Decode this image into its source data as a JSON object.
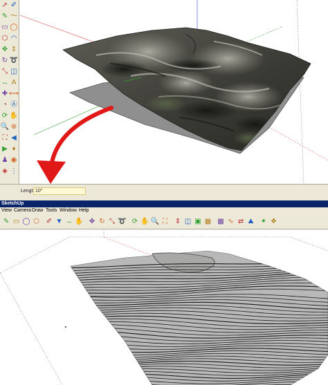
{
  "top": {
    "status_bar": {
      "length_label": "Length",
      "length_value": "10\""
    },
    "left_toolbar_icons": [
      "select-arrow-icon",
      "eraser-icon",
      "pencil-line-icon",
      "freehand-icon",
      "rectangle-icon",
      "circle-icon",
      "polygon-icon",
      "arc-icon",
      "move-icon",
      "push-pull-icon",
      "rotate-icon",
      "follow-me-icon",
      "scale-icon",
      "offset-icon",
      "tape-measure-icon",
      "text-icon",
      "axes-icon",
      "dimension-icon",
      "protractor-icon",
      "3d-text-icon",
      "orbit-icon",
      "pan-icon",
      "zoom-icon",
      "zoom-window-icon",
      "zoom-extents-icon",
      "previous-view-icon",
      "next-view-icon",
      "position-camera-icon",
      "walk-icon",
      "look-around-icon",
      "section-plane-icon",
      "footprints-icon"
    ],
    "terrain_colors": {
      "rock_dark": "#3d3d38",
      "rock_mid": "#6e6e66",
      "rock_light": "#9a9a90",
      "moss": "#5e6a4a",
      "plane": "#8f8f8f"
    },
    "arrow_color": "#e01818"
  },
  "bottom": {
    "window_title": "SketchUp",
    "menu": {
      "view": "View",
      "camera": "Camera",
      "draw": "Draw",
      "tools": "Tools",
      "window": "Window",
      "help": "Help"
    },
    "toolbar_icons": [
      "pencil-line-icon",
      "rectangle-icon",
      "circle-icon",
      "polygon-icon",
      "eraser-icon",
      "paint-bucket-icon",
      "tape-measure-icon",
      "hand-icon",
      "move-icon",
      "rotate-icon",
      "scale-icon",
      "follow-me-icon",
      "orbit-icon",
      "pan-icon",
      "zoom-icon",
      "zoom-extents-icon",
      "push-pull-icon",
      "offset-icon",
      "stamp-icon",
      "drape-icon",
      "sandbox-icon",
      "smoove-icon",
      "flip-edge-icon",
      "terrain-icon",
      "add-detail-icon",
      "component-icon"
    ],
    "contour_color": "#1a1a1a",
    "plane_color": "#b8b8b8"
  },
  "axis_colors": {
    "red": "#e04040",
    "green": "#30a030",
    "blue": "#3050d0"
  }
}
